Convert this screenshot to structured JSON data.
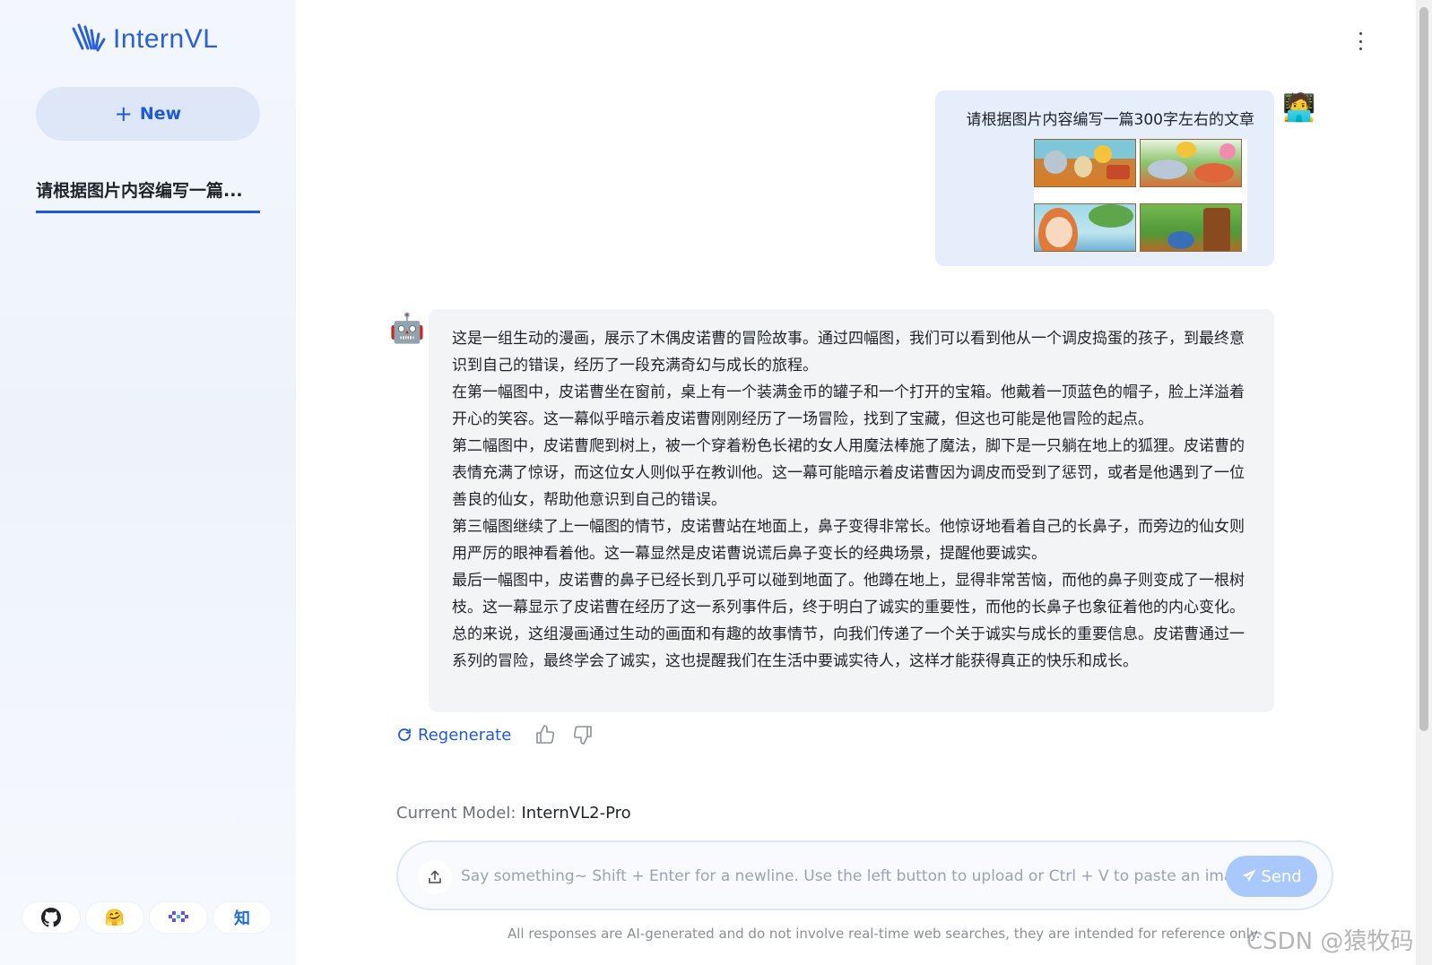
{
  "app": {
    "logo_text": "InternVL",
    "brand_color": "#2b5fd9"
  },
  "sidebar": {
    "new_label": "New",
    "history": [
      {
        "label": "请根据图片内容编写一篇..."
      }
    ],
    "links": [
      {
        "icon": "github-icon"
      },
      {
        "icon": "huggingface-icon"
      },
      {
        "icon": "modelscope-icon"
      },
      {
        "icon": "zhihu-icon",
        "text": "知"
      }
    ]
  },
  "conversation": {
    "user_message": {
      "text": "请根据图片内容编写一篇300字左右的文章",
      "image": "four-panel-comic"
    },
    "bot_message": {
      "paragraphs": [
        "这是一组生动的漫画，展示了木偶皮诺曹的冒险故事。通过四幅图，我们可以看到他从一个调皮捣蛋的孩子，到最终意识到自己的错误，经历了一段充满奇幻与成长的旅程。",
        "在第一幅图中，皮诺曹坐在窗前，桌上有一个装满金币的罐子和一个打开的宝箱。他戴着一顶蓝色的帽子，脸上洋溢着开心的笑容。这一幕似乎暗示着皮诺曹刚刚经历了一场冒险，找到了宝藏，但这也可能是他冒险的起点。",
        "第二幅图中，皮诺曹爬到树上，被一个穿着粉色长裙的女人用魔法棒施了魔法，脚下是一只躺在地上的狐狸。皮诺曹的表情充满了惊讶，而这位女人则似乎在教训他。这一幕可能暗示着皮诺曹因为调皮而受到了惩罚，或者是他遇到了一位善良的仙女，帮助他意识到自己的错误。",
        "第三幅图继续了上一幅图的情节，皮诺曹站在地面上，鼻子变得非常长。他惊讶地看着自己的长鼻子，而旁边的仙女则用严厉的眼神看着他。这一幕显然是皮诺曹说谎后鼻子变长的经典场景，提醒他要诚实。",
        "最后一幅图中，皮诺曹的鼻子已经长到几乎可以碰到地面了。他蹲在地上，显得非常苦恼，而他的鼻子则变成了一根树枝。这一幕显示了皮诺曹在经历了这一系列事件后，终于明白了诚实的重要性，而他的长鼻子也象征着他的内心变化。",
        "总的来说，这组漫画通过生动的画面和有趣的故事情节，向我们传递了一个关于诚实与成长的重要信息。皮诺曹通过一系列的冒险，最终学会了诚实，这也提醒我们在生活中要诚实待人，这样才能获得真正的快乐和成长。"
      ]
    },
    "actions": {
      "regenerate_label": "Regenerate"
    }
  },
  "model": {
    "label": "Current Model:",
    "name": "InternVL2-Pro"
  },
  "composer": {
    "placeholder": "Say something~ Shift + Enter for a newline. Use the left button to upload or Ctrl + V to paste an image.",
    "value": "",
    "send_label": "Send"
  },
  "footer": {
    "disclaimer": "All responses are AI-generated and do not involve real-time web searches, they are intended for reference only.",
    "watermark": "CSDN @猿牧码"
  }
}
